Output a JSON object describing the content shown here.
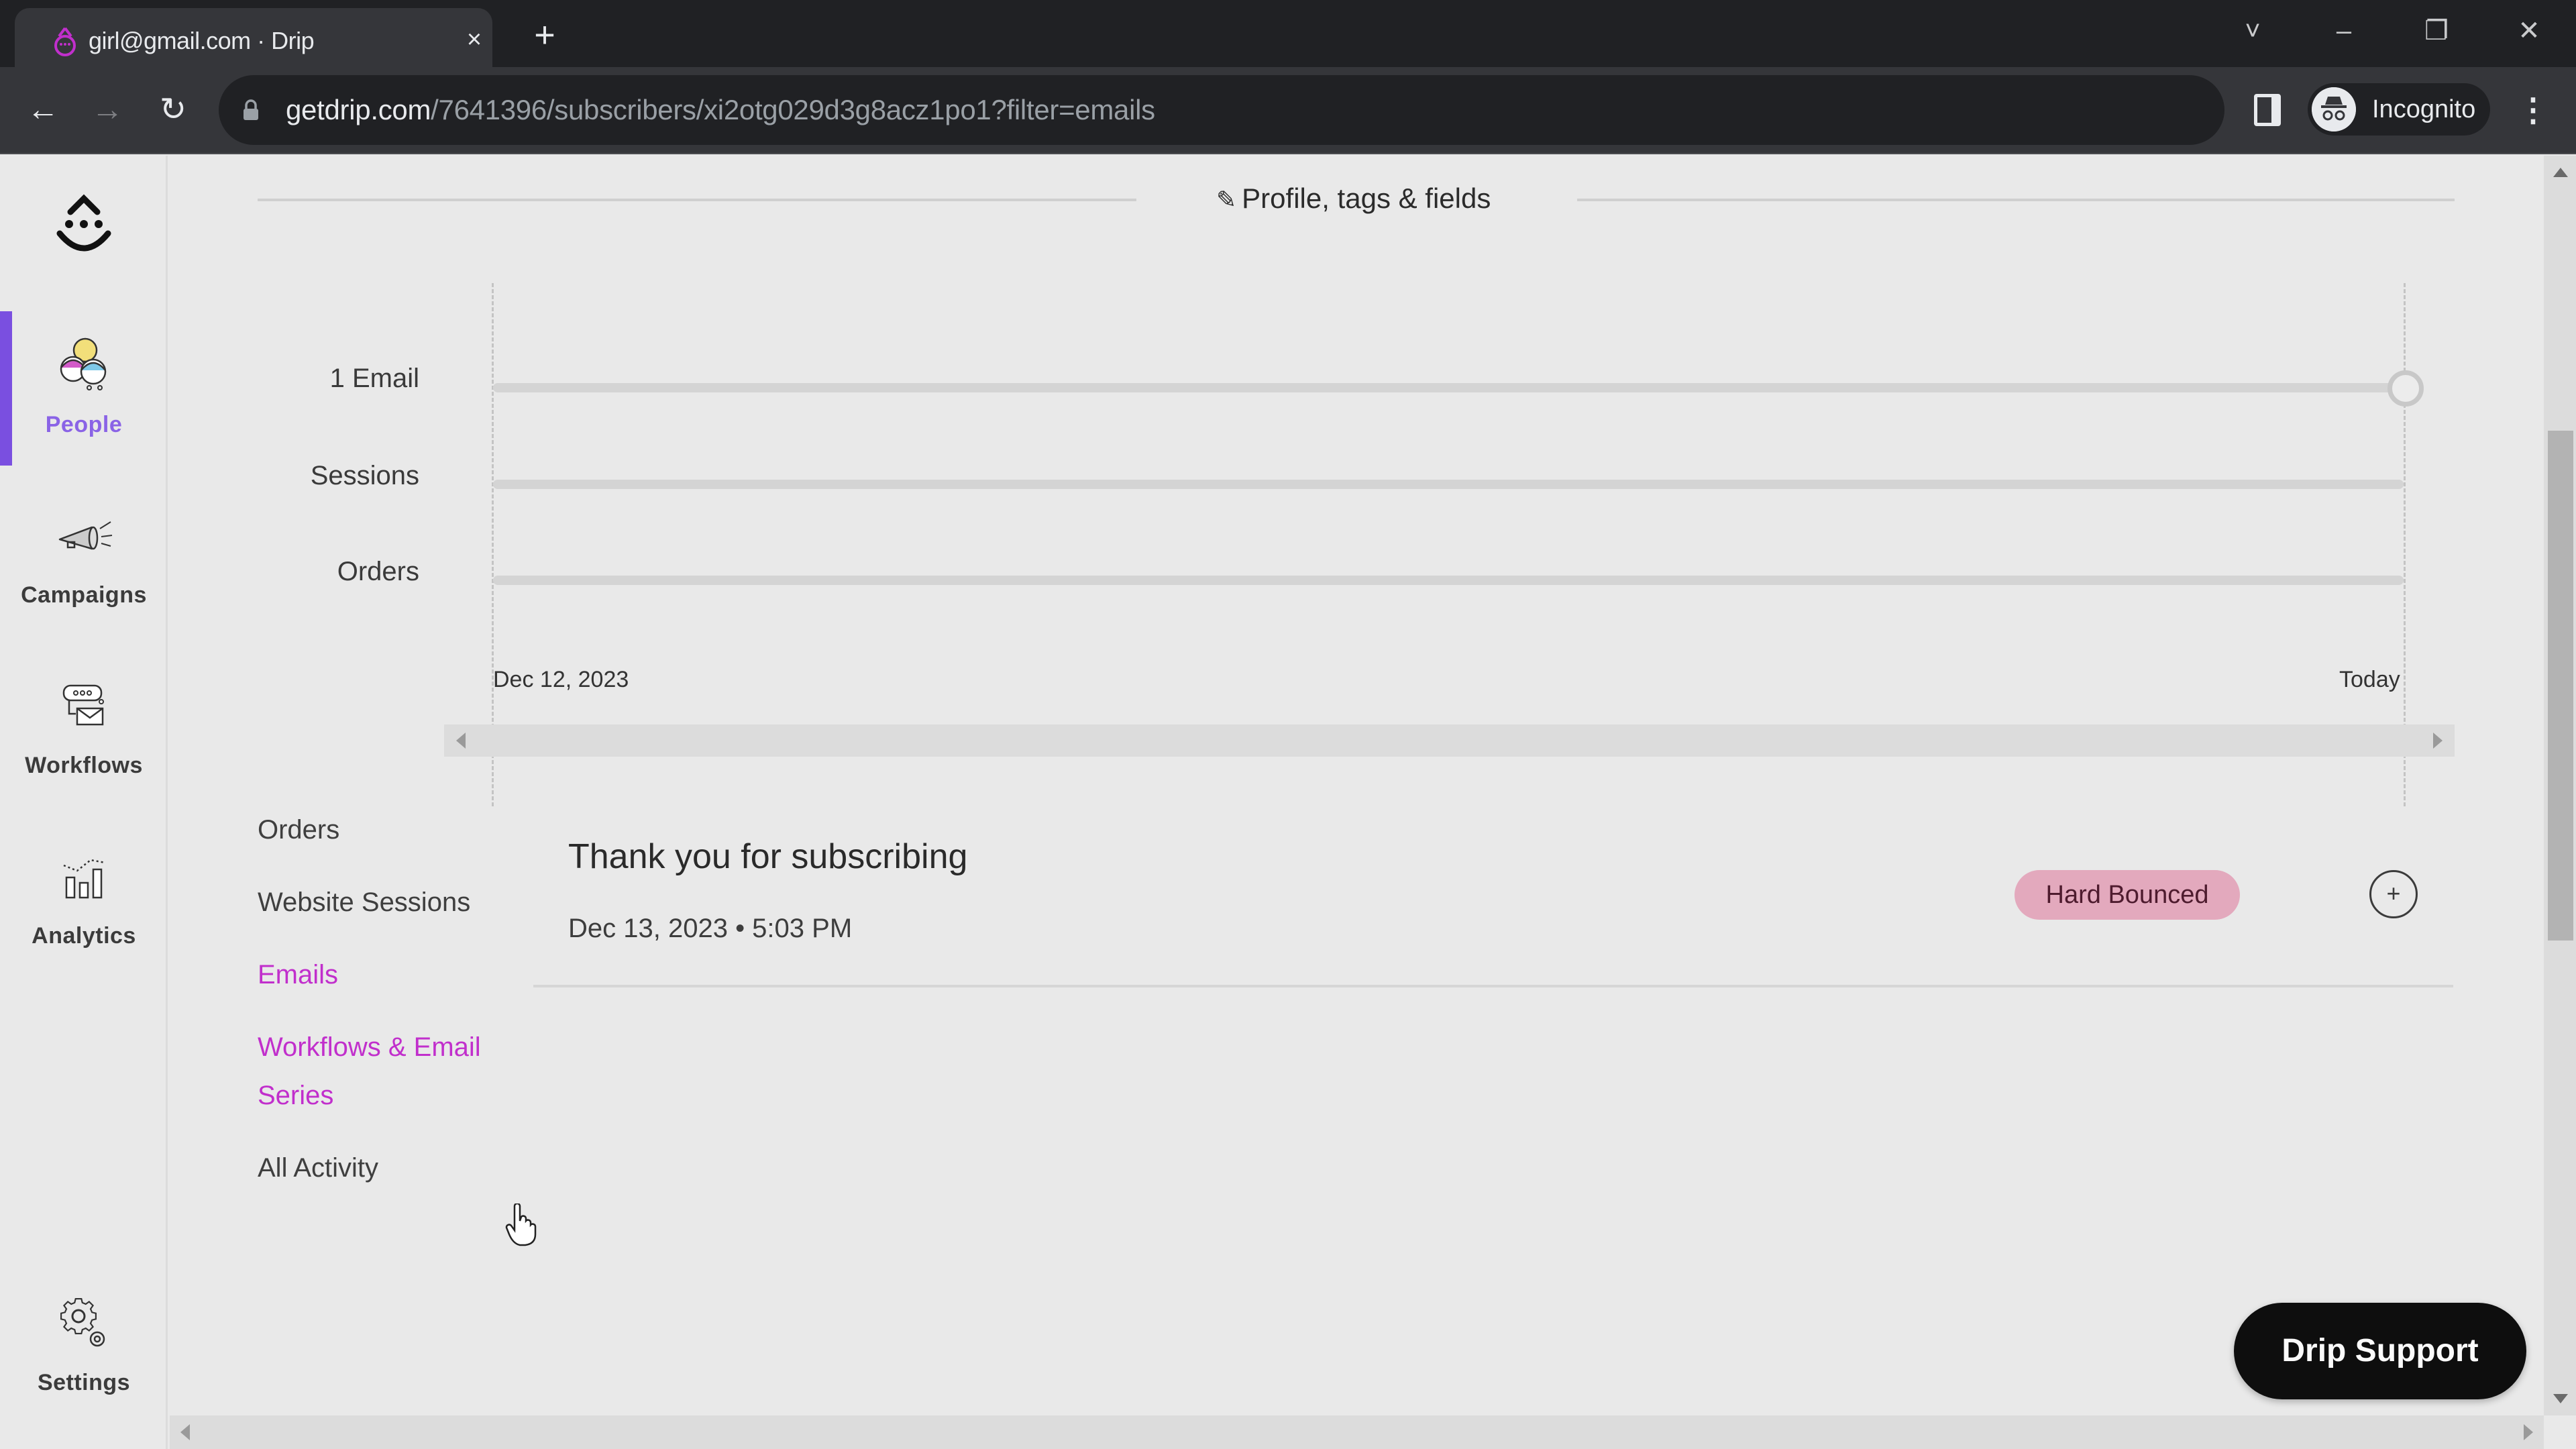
{
  "browser": {
    "tab": {
      "title": "girl@gmail.com · Drip",
      "close_icon": "close-icon"
    },
    "new_tab_icon": "plus-icon",
    "window_controls": {
      "tab_search": "˅",
      "minimize": "–",
      "restore": "❐",
      "close": "✕"
    },
    "nav": {
      "back": "←",
      "forward": "→",
      "reload": "↻"
    },
    "url": {
      "host": "getdrip.com",
      "path": "/7641396/subscribers/xi2otg029d3g8acz1po1?filter=emails"
    },
    "bookmark_icon": "☆",
    "profile_label": "Incognito",
    "menu_icon": "⋮"
  },
  "sidebar": {
    "logo": "drip-logo",
    "items": [
      {
        "label": "People",
        "icon": "people-icon",
        "active": true
      },
      {
        "label": "Campaigns",
        "icon": "megaphone-icon",
        "active": false
      },
      {
        "label": "Workflows",
        "icon": "workflow-icon",
        "active": false
      },
      {
        "label": "Analytics",
        "icon": "analytics-icon",
        "active": false
      }
    ],
    "settings": {
      "label": "Settings",
      "icon": "gear-icon"
    },
    "accent_color": "#7a4fe0"
  },
  "profile_header": {
    "label": "Profile, tags & fields",
    "icon": "pencil-icon"
  },
  "timeline": {
    "rows": [
      {
        "label": "1 Email",
        "has_event_today": true
      },
      {
        "label": "Sessions",
        "has_event_today": false
      },
      {
        "label": "Orders",
        "has_event_today": false
      }
    ],
    "start_label": "Dec 12, 2023",
    "end_label": "Today"
  },
  "subnav": {
    "items": [
      {
        "label": "Orders",
        "active": false
      },
      {
        "label": "Website Sessions",
        "active": false
      },
      {
        "label": "Emails",
        "active": true
      },
      {
        "label": "Workflows & Email",
        "label_line2": "Series",
        "active": false,
        "hovered": true
      },
      {
        "label": "All Activity",
        "active": false
      }
    ],
    "accent_color": "#c12fcc"
  },
  "emails": [
    {
      "subject": "Thank you for subscribing",
      "sent_at": "Dec 13, 2023 • 5:03 PM",
      "status": "Hard Bounced",
      "status_color": "#e3a9bd",
      "expand_label": "+"
    }
  ],
  "support_button": {
    "label": "Drip Support"
  }
}
